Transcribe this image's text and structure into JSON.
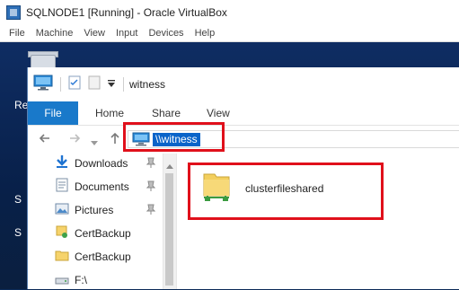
{
  "vbox": {
    "title": "SQLNODE1 [Running] - Oracle VirtualBox",
    "menu": [
      "File",
      "Machine",
      "View",
      "Input",
      "Devices",
      "Help"
    ]
  },
  "desktop": {
    "label_re": "Re",
    "label_s1": "S",
    "label_s2": "S"
  },
  "explorer": {
    "window_title": "witness",
    "tabs": [
      "File",
      "Home",
      "Share",
      "View"
    ],
    "address": "\\\\witness",
    "nav_items": [
      {
        "label": "Downloads",
        "icon": "download-icon",
        "pinned": true
      },
      {
        "label": "Documents",
        "icon": "documents-icon",
        "pinned": true
      },
      {
        "label": "Pictures",
        "icon": "pictures-icon",
        "pinned": true
      },
      {
        "label": "CertBackup",
        "icon": "certificate-folder-icon",
        "pinned": false
      },
      {
        "label": "CertBackup",
        "icon": "folder-icon",
        "pinned": false
      },
      {
        "label": "F:\\",
        "icon": "drive-icon",
        "pinned": false
      }
    ],
    "content_items": [
      {
        "label": "clusterfileshared",
        "icon": "network-share-folder-icon"
      }
    ]
  },
  "colors": {
    "highlight": "#e0101b",
    "file_tab": "#1979ca",
    "selection": "#0a64c9"
  }
}
